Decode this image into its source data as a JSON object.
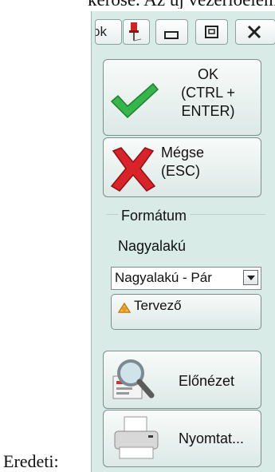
{
  "document": {
    "top_text": "kerősé. Az új vezérlőelem",
    "caption": "Eredeti:"
  },
  "titlebar": {
    "ok_fragment": "ok"
  },
  "buttons": {
    "ok_label": "OK\n(CTRL +\nENTER)",
    "cancel_label": "Mégse\n(ESC)",
    "preview_label": "Előnézet",
    "print_label": "Nyomtat..."
  },
  "format_group": {
    "title": "Formátum",
    "orientation_label": "Nagyalakú",
    "select_value": "Nagyalakú - Pár",
    "designer_label": "Tervező"
  },
  "colors": {
    "panel_bg": "#d9ebe7",
    "check_green": "#35b54a",
    "cross_red": "#d9232a"
  }
}
